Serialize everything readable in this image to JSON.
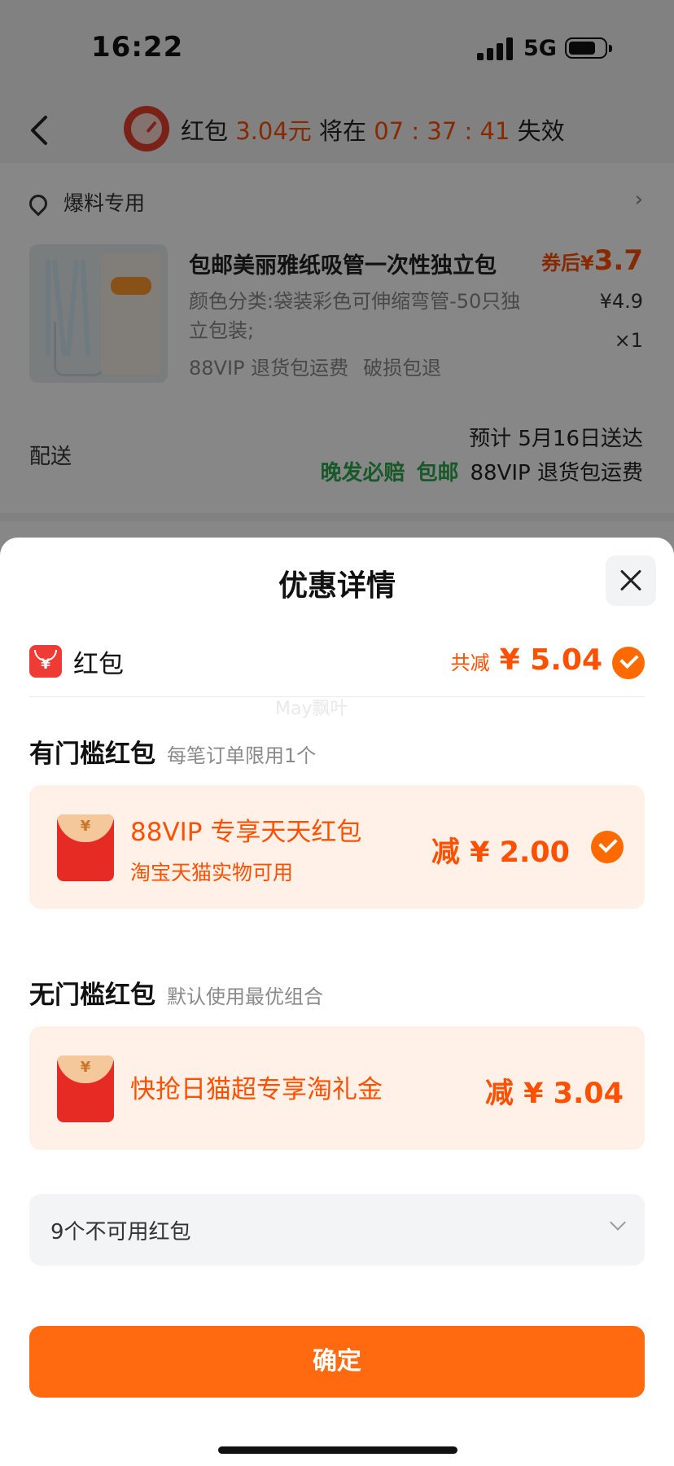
{
  "status_bar": {
    "time": "16:22",
    "network": "5G"
  },
  "header": {
    "prefix": "红包",
    "amount": "3.04元",
    "middle": "将在",
    "countdown": "07 : 37 : 41",
    "suffix": "失效"
  },
  "address": {
    "label": "爆料专用",
    "chevron": "›"
  },
  "product": {
    "title": "包邮美丽雅纸吸管一次性独立包",
    "sku": "颜色分类:袋装彩色可伸缩弯管-50只独立包装;",
    "tags": [
      "88VIP 退货包运费",
      "破损包退"
    ],
    "price_after_label": "券后¥",
    "price_after": "3.7",
    "price_original": "¥4.9",
    "quantity": "×1"
  },
  "shipping": {
    "label": "配送",
    "eta": "预计 5月16日送达",
    "tags": [
      "晚发必赔",
      "包邮"
    ],
    "extra": "88VIP 退货包运费"
  },
  "sheet": {
    "title": "优惠详情",
    "hongbao_label": "红包",
    "total_prefix": "共减",
    "total_amount": "¥ 5.04",
    "watermark": "May飘叶",
    "threshold_section": {
      "title": "有门槛红包",
      "note": "每笔订单限用1个"
    },
    "coupon1": {
      "title": "88VIP 专享天天红包",
      "subtitle": "淘宝天猫实物可用",
      "amount": "减 ¥ 2.00"
    },
    "no_threshold_section": {
      "title": "无门槛红包",
      "note": "默认使用最优组合"
    },
    "coupon2": {
      "title": "快抢日猫超专享淘礼金",
      "amount": "减 ¥ 3.04"
    },
    "unavailable": "9个不可用红包",
    "confirm": "确定"
  },
  "colors": {
    "accent": "#ff5000",
    "green": "#2fa84f",
    "button": "#ff6a10"
  },
  "icons": [
    "back-icon",
    "timer-icon",
    "location-pin-icon",
    "close-icon",
    "hongbao-icon",
    "check-icon",
    "red-envelope-icon",
    "chevron-down-icon"
  ]
}
